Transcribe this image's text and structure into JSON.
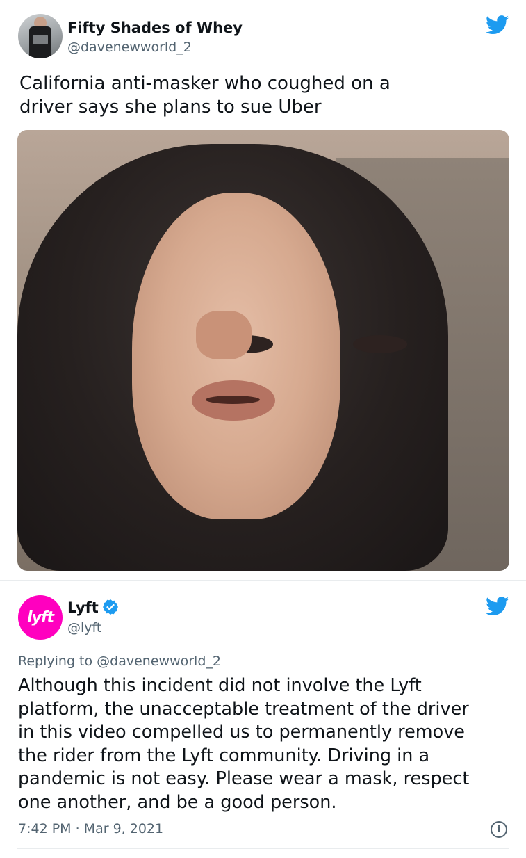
{
  "tweets": [
    {
      "author_name": "Fifty Shades of Whey",
      "handle": "@davenewworld_2",
      "text_lines": [
        "California anti-masker who coughed on a",
        "driver says she plans to sue Uber"
      ],
      "has_media": true
    },
    {
      "author_name": "Lyft",
      "avatar_text": "lyft",
      "handle": "@lyft",
      "verified": true,
      "replying_prefix": "Replying to",
      "replying_to": "@davenewworld_2",
      "text_lines": [
        "Although this incident did not involve the Lyft",
        "platform, the unacceptable treatment of the driver",
        "in this video compelled us to permanently remove",
        "the rider from the Lyft community. Driving in a",
        "pandemic is not easy. Please wear a mask, respect",
        "one another, and be a good person."
      ],
      "timestamp": "7:42 PM · Mar 9, 2021"
    }
  ],
  "colors": {
    "twitter_blue": "#1d9bf0",
    "lyft_pink": "#ff00bf",
    "text_primary": "#0f1419",
    "text_secondary": "#536471"
  },
  "icons": {
    "platform": "twitter-bird-icon",
    "verified": "verified-badge-icon",
    "info": "info-icon"
  }
}
